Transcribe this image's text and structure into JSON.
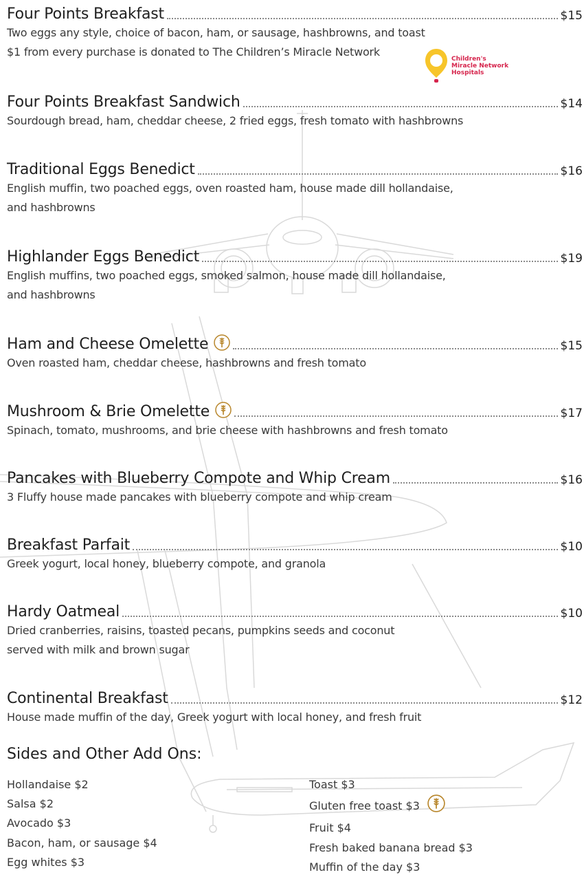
{
  "donation_logo": {
    "line1": "Children's",
    "line2": "Miracle Network",
    "line3": "Hospitals"
  },
  "items": [
    {
      "name": "Four Points Breakfast",
      "price": "$15",
      "desc": [
        "Two eggs any style, choice of bacon, ham, or sausage, hashbrowns, and toast",
        "$1 from every purchase is donated to The Children’s Miracle Network"
      ]
    },
    {
      "name": "Four Points Breakfast Sandwich",
      "price": "$14",
      "desc": [
        "Sourdough bread, ham, cheddar cheese, 2 fried eggs, fresh tomato with hashbrowns"
      ]
    },
    {
      "name": "Traditional Eggs Benedict",
      "price": "$16",
      "desc": [
        "English muffin, two poached eggs, oven roasted ham, house made dill hollandaise,",
        "and hashbrowns"
      ]
    },
    {
      "name": "Highlander Eggs Benedict",
      "price": "$19",
      "desc": [
        "English muffins, two poached eggs, smoked salmon, house made dill hollandaise,",
        "and hashbrowns"
      ]
    },
    {
      "name": "Ham and Cheese Omelette",
      "price": "$15",
      "desc": [
        "Oven roasted ham, cheddar cheese, hashbrowns and fresh tomato"
      ]
    },
    {
      "name": "Mushroom & Brie Omelette",
      "price": "$17",
      "desc": [
        "Spinach, tomato, mushrooms, and brie cheese with hashbrowns and fresh tomato"
      ]
    },
    {
      "name": "Pancakes with Blueberry Compote and Whip Cream",
      "price": "$16",
      "desc": [
        "3 Fluffy house made pancakes with blueberry compote and whip cream"
      ]
    },
    {
      "name": "Breakfast Parfait",
      "price": "$10",
      "desc": [
        "Greek yogurt, local honey, blueberry compote, and granola"
      ]
    },
    {
      "name": "Hardy Oatmeal",
      "price": "$10",
      "desc": [
        "Dried cranberries, raisins, toasted pecans, pumpkins seeds and coconut",
        "served with milk and brown sugar"
      ]
    },
    {
      "name": "Continental Breakfast",
      "price": "$12",
      "desc": [
        "House made muffin of the day, Greek yogurt with local honey, and fresh fruit"
      ]
    }
  ],
  "sides": {
    "title": "Sides and Other Add Ons:",
    "left": [
      "Hollandaise $2",
      "Salsa $2",
      "Avocado $3",
      "Bacon, ham, or sausage $4",
      "Egg whites $3"
    ],
    "right": [
      "Toast $3",
      "Gluten free toast $3",
      "Fruit $4",
      "Fresh baked banana bread $3",
      "Muffin of the day $3"
    ]
  },
  "icons": {
    "gluten_free": "wheat-icon",
    "charity": "cmn-balloon-icon"
  },
  "colors": {
    "badge_gold": "#b8862b",
    "cmn_red": "#d6254d",
    "cmn_yellow": "#f7c52a"
  }
}
